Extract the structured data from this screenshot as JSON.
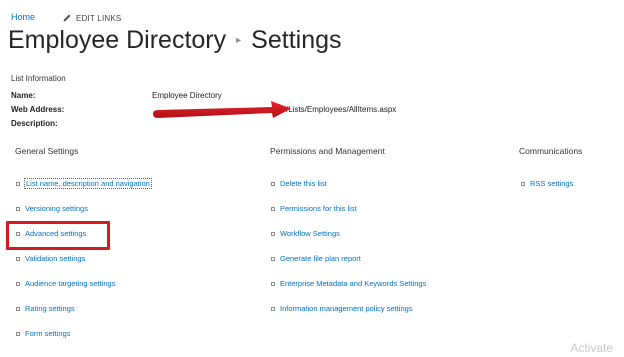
{
  "nav": {
    "home_label": "Home",
    "edit_links_label": "EDIT LINKS"
  },
  "title": {
    "list_name": "Employee Directory",
    "page_name": "Settings"
  },
  "list_information": {
    "header": "List Information",
    "name_label": "Name:",
    "name_value": "Employee Directory",
    "web_address_label": "Web Address:",
    "web_address_value": "/Lists/Employees/AllItems.aspx",
    "description_label": "Description:"
  },
  "sections": {
    "general": {
      "header": "General Settings",
      "items": [
        "List name, description and navigation",
        "Versioning settings",
        "Advanced settings",
        "Validation settings",
        "Audience targeting settings",
        "Rating settings",
        "Form settings"
      ]
    },
    "permissions": {
      "header": "Permissions and Management",
      "items": [
        "Delete this list",
        "Permissions for this list",
        "Workflow Settings",
        "Generate file plan report",
        "Enterprise Metadata and Keywords Settings",
        "Information management policy settings"
      ]
    },
    "communications": {
      "header": "Communications",
      "items": [
        "RSS settings"
      ]
    }
  },
  "annotations": {
    "arrow_color": "#d71920",
    "highlight_color": "#d71920",
    "highlighted_item": "Advanced settings"
  },
  "watermark": "Activate",
  "colors": {
    "link": "#0072c6",
    "text": "#262626"
  }
}
